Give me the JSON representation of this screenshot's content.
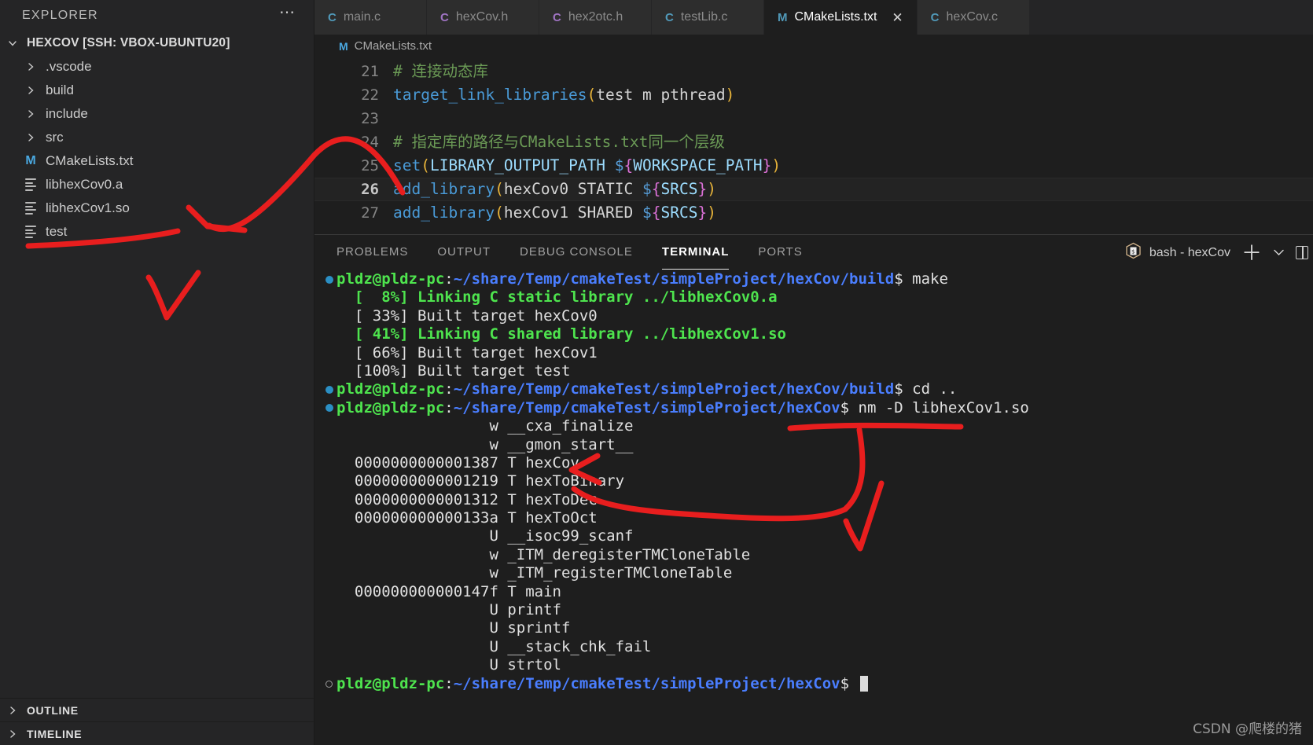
{
  "sidebar": {
    "header": "EXPLORER",
    "more_icon": "ellipsis-icon",
    "root": {
      "label": "HEXCOV [SSH: VBOX-UBUNTU20]",
      "expanded": true
    },
    "items": [
      {
        "label": ".vscode",
        "type": "folder",
        "icon": "chevron-right-icon"
      },
      {
        "label": "build",
        "type": "folder",
        "icon": "chevron-right-icon"
      },
      {
        "label": "include",
        "type": "folder",
        "icon": "chevron-right-icon"
      },
      {
        "label": "src",
        "type": "folder",
        "icon": "chevron-right-icon"
      },
      {
        "label": "CMakeLists.txt",
        "type": "file",
        "icon": "markdown-m-icon"
      },
      {
        "label": "libhexCov0.a",
        "type": "file",
        "icon": "lines-file-icon"
      },
      {
        "label": "libhexCov1.so",
        "type": "file",
        "icon": "lines-file-icon"
      },
      {
        "label": "test",
        "type": "file",
        "icon": "lines-file-icon"
      }
    ],
    "sections": [
      {
        "label": "OUTLINE",
        "expanded": false
      },
      {
        "label": "TIMELINE",
        "expanded": false
      }
    ]
  },
  "editor": {
    "tabs": [
      {
        "label": "main.c",
        "icon": "c-file-icon",
        "icon_color": "#519aba",
        "active": false,
        "closable": false
      },
      {
        "label": "hexCov.h",
        "icon": "c-file-icon",
        "icon_color": "#a074c4",
        "active": false,
        "closable": false
      },
      {
        "label": "hex2otc.h",
        "icon": "c-file-icon",
        "icon_color": "#a074c4",
        "active": false,
        "closable": false
      },
      {
        "label": "testLib.c",
        "icon": "c-file-icon",
        "icon_color": "#519aba",
        "active": false,
        "closable": false
      },
      {
        "label": "CMakeLists.txt",
        "icon": "markdown-m-icon",
        "icon_color": "#519aba",
        "active": true,
        "closable": true
      },
      {
        "label": "hexCov.c",
        "icon": "c-file-icon",
        "icon_color": "#519aba",
        "active": false,
        "closable": false
      }
    ],
    "close_glyph": "✕",
    "breadcrumb": {
      "icon": "markdown-m-icon",
      "label": "CMakeLists.txt"
    },
    "current_line": 26,
    "lines": [
      {
        "num": 21,
        "tokens": [
          {
            "t": "# 连接动态库",
            "c": "k-com"
          }
        ]
      },
      {
        "num": 22,
        "tokens": [
          {
            "t": "target_link_libraries",
            "c": "k-fn"
          },
          {
            "t": "(",
            "c": "k-par"
          },
          {
            "t": "test m pthread",
            "c": "k-plain"
          },
          {
            "t": ")",
            "c": "k-par"
          }
        ]
      },
      {
        "num": 23,
        "tokens": []
      },
      {
        "num": 24,
        "tokens": [
          {
            "t": "# 指定库的路径与CMakeLists.txt同一个层级",
            "c": "k-com"
          }
        ]
      },
      {
        "num": 25,
        "tokens": [
          {
            "t": "set",
            "c": "k-fn"
          },
          {
            "t": "(",
            "c": "k-par"
          },
          {
            "t": "LIBRARY_OUTPUT_PATH ",
            "c": "k-var"
          },
          {
            "t": "$",
            "c": "k-dollar"
          },
          {
            "t": "{",
            "c": "k-brace"
          },
          {
            "t": "WORKSPACE_PATH",
            "c": "k-var"
          },
          {
            "t": "}",
            "c": "k-brace"
          },
          {
            "t": ")",
            "c": "k-par"
          }
        ]
      },
      {
        "num": 26,
        "tokens": [
          {
            "t": "add_library",
            "c": "k-fn"
          },
          {
            "t": "(",
            "c": "k-par"
          },
          {
            "t": "hexCov0 STATIC ",
            "c": "k-plain"
          },
          {
            "t": "$",
            "c": "k-dollar"
          },
          {
            "t": "{",
            "c": "k-brace"
          },
          {
            "t": "SRCS",
            "c": "k-var"
          },
          {
            "t": "}",
            "c": "k-brace"
          },
          {
            "t": ")",
            "c": "k-par"
          }
        ]
      },
      {
        "num": 27,
        "tokens": [
          {
            "t": "add_library",
            "c": "k-fn"
          },
          {
            "t": "(",
            "c": "k-par"
          },
          {
            "t": "hexCov1 SHARED ",
            "c": "k-plain"
          },
          {
            "t": "$",
            "c": "k-dollar"
          },
          {
            "t": "{",
            "c": "k-brace"
          },
          {
            "t": "SRCS",
            "c": "k-var"
          },
          {
            "t": "}",
            "c": "k-brace"
          },
          {
            "t": ")",
            "c": "k-par"
          }
        ]
      }
    ]
  },
  "panel": {
    "tabs": [
      {
        "label": "PROBLEMS",
        "active": false
      },
      {
        "label": "OUTPUT",
        "active": false
      },
      {
        "label": "DEBUG CONSOLE",
        "active": false
      },
      {
        "label": "TERMINAL",
        "active": true
      },
      {
        "label": "PORTS",
        "active": false
      }
    ],
    "terminal_selector": {
      "icon": "terminal-box-icon",
      "label": "bash - hexCov"
    },
    "new_terminal_icon": "plus-icon",
    "dropdown_icon": "chevron-down-icon",
    "split_icon": "split-terminal-icon"
  },
  "terminal": {
    "prompt_user": "pldz@pldz-pc",
    "lines": [
      {
        "marker": "filled",
        "segs": [
          {
            "t": "pldz@pldz-pc",
            "c": "t-user"
          },
          {
            "t": ":",
            "c": "t-plain"
          },
          {
            "t": "~/share/Temp/cmakeTest/simpleProject/hexCov/build",
            "c": "t-path"
          },
          {
            "t": "$ make",
            "c": "t-cmd"
          }
        ]
      },
      {
        "marker": "none",
        "segs": [
          {
            "t": "  [  8%] Linking C static library ../libhexCov0.a",
            "c": "t-green"
          }
        ]
      },
      {
        "marker": "none",
        "segs": [
          {
            "t": "  [ 33%] Built target hexCov0",
            "c": "t-plain"
          }
        ]
      },
      {
        "marker": "none",
        "segs": [
          {
            "t": "  [ 41%] Linking C shared library ../libhexCov1.so",
            "c": "t-green"
          }
        ]
      },
      {
        "marker": "none",
        "segs": [
          {
            "t": "  [ 66%] Built target hexCov1",
            "c": "t-plain"
          }
        ]
      },
      {
        "marker": "none",
        "segs": [
          {
            "t": "  [100%] Built target test",
            "c": "t-plain"
          }
        ]
      },
      {
        "marker": "filled",
        "segs": [
          {
            "t": "pldz@pldz-pc",
            "c": "t-user"
          },
          {
            "t": ":",
            "c": "t-plain"
          },
          {
            "t": "~/share/Temp/cmakeTest/simpleProject/hexCov/build",
            "c": "t-path"
          },
          {
            "t": "$ cd ..",
            "c": "t-cmd"
          }
        ]
      },
      {
        "marker": "filled",
        "segs": [
          {
            "t": "pldz@pldz-pc",
            "c": "t-user"
          },
          {
            "t": ":",
            "c": "t-plain"
          },
          {
            "t": "~/share/Temp/cmakeTest/simpleProject/hexCov",
            "c": "t-path"
          },
          {
            "t": "$ nm -D libhexCov1.so",
            "c": "t-cmd"
          }
        ]
      },
      {
        "marker": "none",
        "segs": [
          {
            "t": "                 w __cxa_finalize",
            "c": "t-plain"
          }
        ]
      },
      {
        "marker": "none",
        "segs": [
          {
            "t": "                 w __gmon_start__",
            "c": "t-plain"
          }
        ]
      },
      {
        "marker": "none",
        "segs": [
          {
            "t": "  0000000000001387 T hexCov",
            "c": "t-plain"
          }
        ]
      },
      {
        "marker": "none",
        "segs": [
          {
            "t": "  0000000000001219 T hexToBinary",
            "c": "t-plain"
          }
        ]
      },
      {
        "marker": "none",
        "segs": [
          {
            "t": "  0000000000001312 T hexToDec",
            "c": "t-plain"
          }
        ]
      },
      {
        "marker": "none",
        "segs": [
          {
            "t": "  000000000000133a T hexToOct",
            "c": "t-plain"
          }
        ]
      },
      {
        "marker": "none",
        "segs": [
          {
            "t": "                 U __isoc99_scanf",
            "c": "t-plain"
          }
        ]
      },
      {
        "marker": "none",
        "segs": [
          {
            "t": "                 w _ITM_deregisterTMCloneTable",
            "c": "t-plain"
          }
        ]
      },
      {
        "marker": "none",
        "segs": [
          {
            "t": "                 w _ITM_registerTMCloneTable",
            "c": "t-plain"
          }
        ]
      },
      {
        "marker": "none",
        "segs": [
          {
            "t": "  000000000000147f T main",
            "c": "t-plain"
          }
        ]
      },
      {
        "marker": "none",
        "segs": [
          {
            "t": "                 U printf",
            "c": "t-plain"
          }
        ]
      },
      {
        "marker": "none",
        "segs": [
          {
            "t": "                 U sprintf",
            "c": "t-plain"
          }
        ]
      },
      {
        "marker": "none",
        "segs": [
          {
            "t": "                 U __stack_chk_fail",
            "c": "t-plain"
          }
        ]
      },
      {
        "marker": "none",
        "segs": [
          {
            "t": "                 U strtol",
            "c": "t-plain"
          }
        ]
      },
      {
        "marker": "hollow",
        "cursor": true,
        "segs": [
          {
            "t": "pldz@pldz-pc",
            "c": "t-user"
          },
          {
            "t": ":",
            "c": "t-plain"
          },
          {
            "t": "~/share/Temp/cmakeTest/simpleProject/hexCov",
            "c": "t-path"
          },
          {
            "t": "$ ",
            "c": "t-cmd"
          }
        ]
      }
    ]
  },
  "annotations": {
    "color": "#e81e1e",
    "marks": [
      {
        "name": "arrow-to-sidebar-files",
        "kind": "arrow"
      },
      {
        "name": "underline-sidebar-files",
        "kind": "underline"
      },
      {
        "name": "checkmark-sidebar",
        "kind": "check"
      },
      {
        "name": "underline-nm-command",
        "kind": "underline"
      },
      {
        "name": "arrow-to-hexcov-symbol",
        "kind": "arrow"
      },
      {
        "name": "checkmark-terminal",
        "kind": "check"
      }
    ]
  },
  "watermark": "CSDN @爬楼的猪"
}
